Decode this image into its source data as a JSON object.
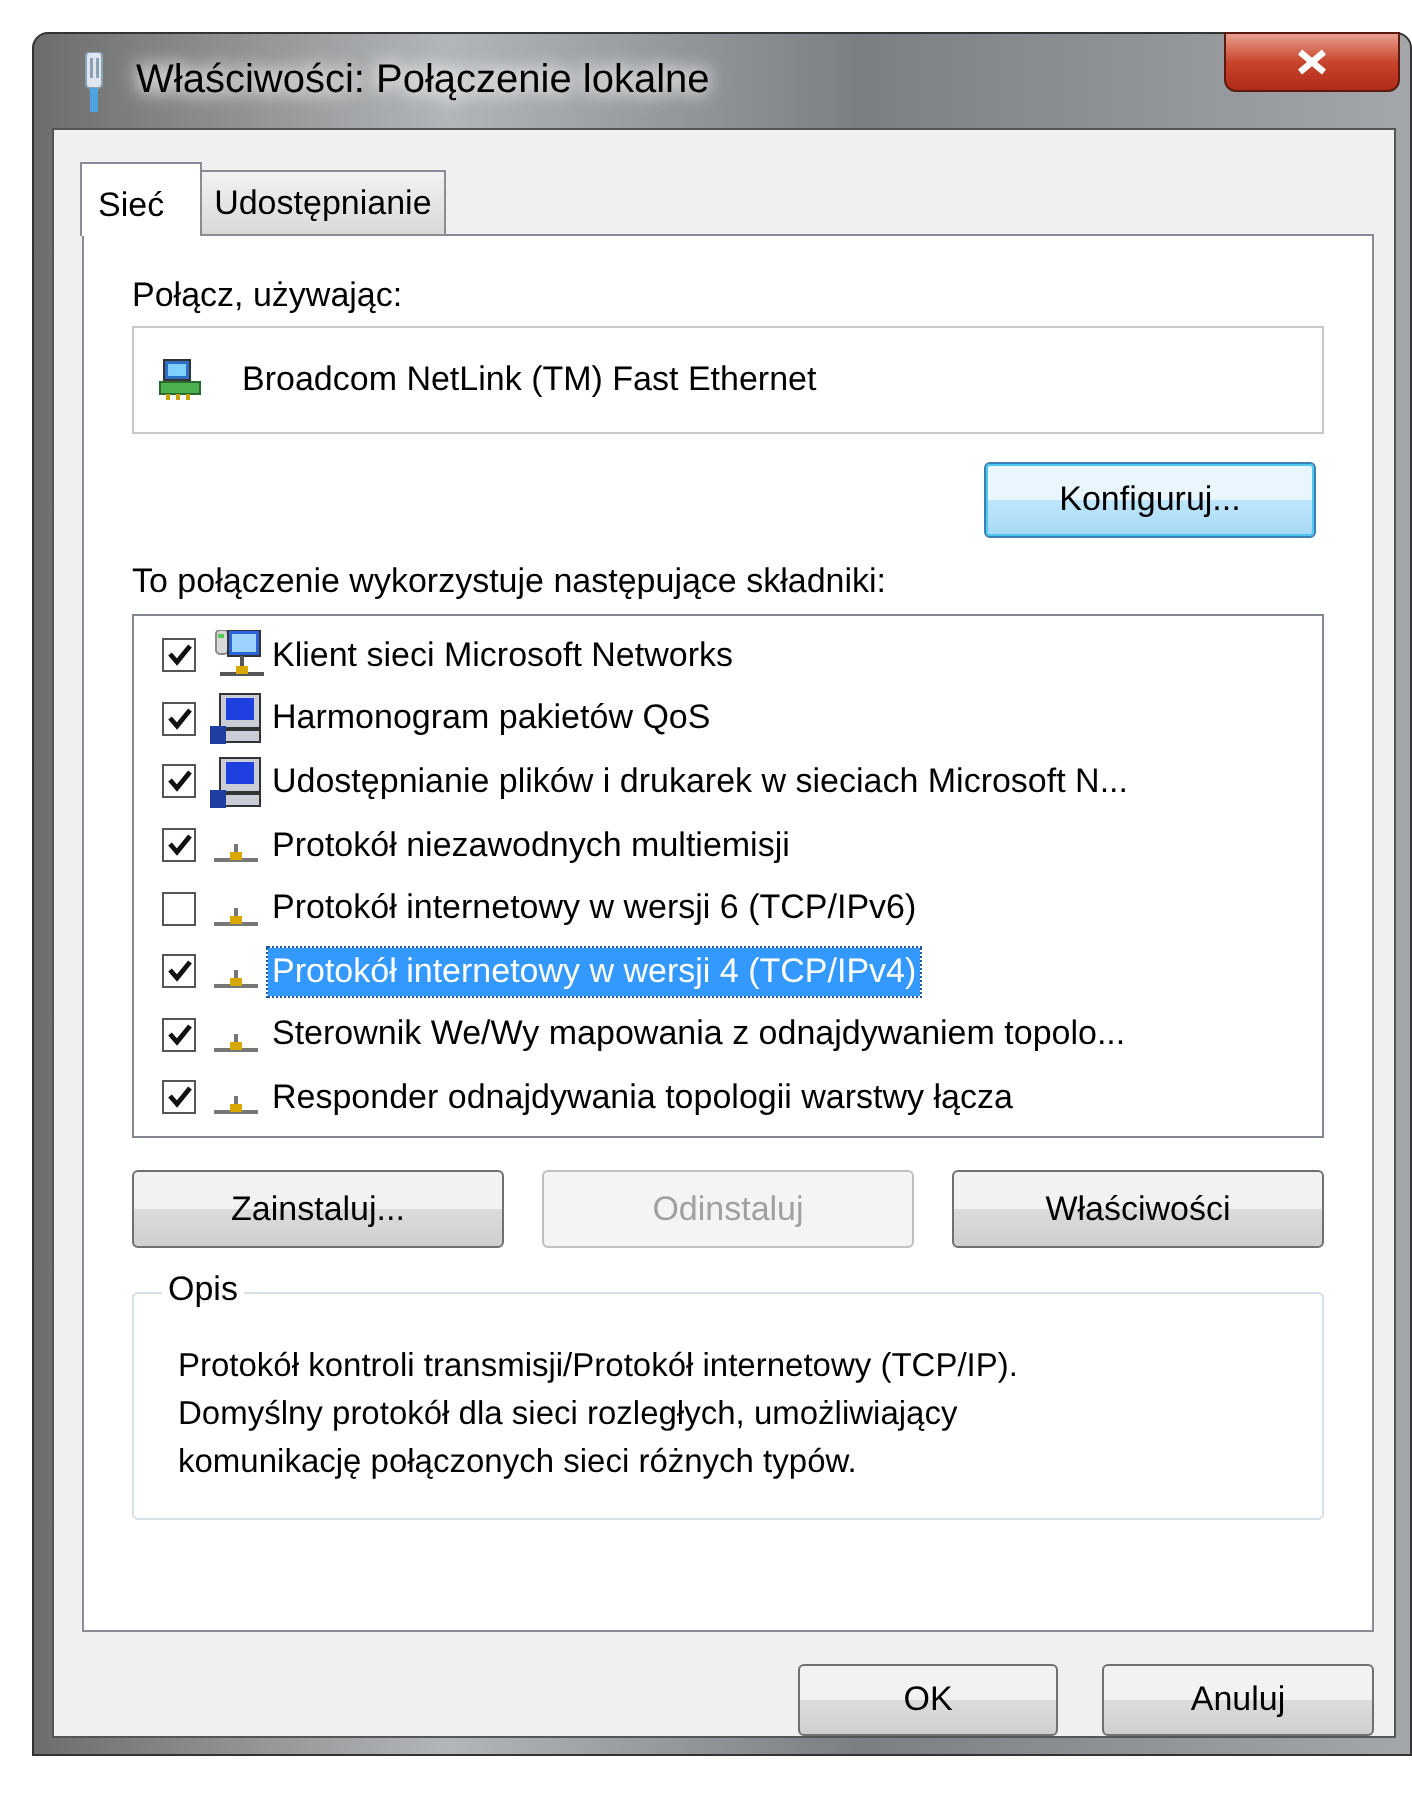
{
  "window": {
    "title": "Właściwości: Połączenie lokalne"
  },
  "tabs": [
    {
      "label": "Sieć",
      "selected": true
    },
    {
      "label": "Udostępnianie",
      "selected": false
    }
  ],
  "connect_using": {
    "label": "Połącz, używając:",
    "adapter": "Broadcom NetLink (TM) Fast Ethernet",
    "configure_button": "Konfiguruj..."
  },
  "components": {
    "label": "To połączenie wykorzystuje następujące składniki:",
    "items": [
      {
        "kind": "client",
        "label": "Klient sieci Microsoft Networks",
        "checked": true,
        "selected": false
      },
      {
        "kind": "service",
        "label": "Harmonogram pakietów QoS",
        "checked": true,
        "selected": false
      },
      {
        "kind": "service",
        "label": "Udostępnianie plików i drukarek w sieciach Microsoft N...",
        "checked": true,
        "selected": false
      },
      {
        "kind": "protocol",
        "label": "Protokół niezawodnych multiemisji",
        "checked": true,
        "selected": false
      },
      {
        "kind": "protocol",
        "label": "Protokół internetowy w wersji 6 (TCP/IPv6)",
        "checked": false,
        "selected": false
      },
      {
        "kind": "protocol",
        "label": "Protokół internetowy w wersji 4 (TCP/IPv4)",
        "checked": true,
        "selected": true
      },
      {
        "kind": "protocol",
        "label": "Sterownik We/Wy mapowania z odnajdywaniem topolo...",
        "checked": true,
        "selected": false
      },
      {
        "kind": "protocol",
        "label": "Responder odnajdywania topologii warstwy łącza",
        "checked": true,
        "selected": false
      }
    ]
  },
  "component_buttons": [
    {
      "label": "Zainstaluj...",
      "disabled": false
    },
    {
      "label": "Odinstaluj",
      "disabled": true
    },
    {
      "label": "Właściwości",
      "disabled": false
    }
  ],
  "description": {
    "label": "Opis",
    "lines": [
      "Protokół kontroli transmisji/Protokół internetowy (TCP/IP).",
      "Domyślny protokół dla sieci rozległych, umożliwiający",
      "komunikację połączonych sieci różnych typów."
    ]
  },
  "dialog_buttons": [
    "OK",
    "Anuluj"
  ]
}
